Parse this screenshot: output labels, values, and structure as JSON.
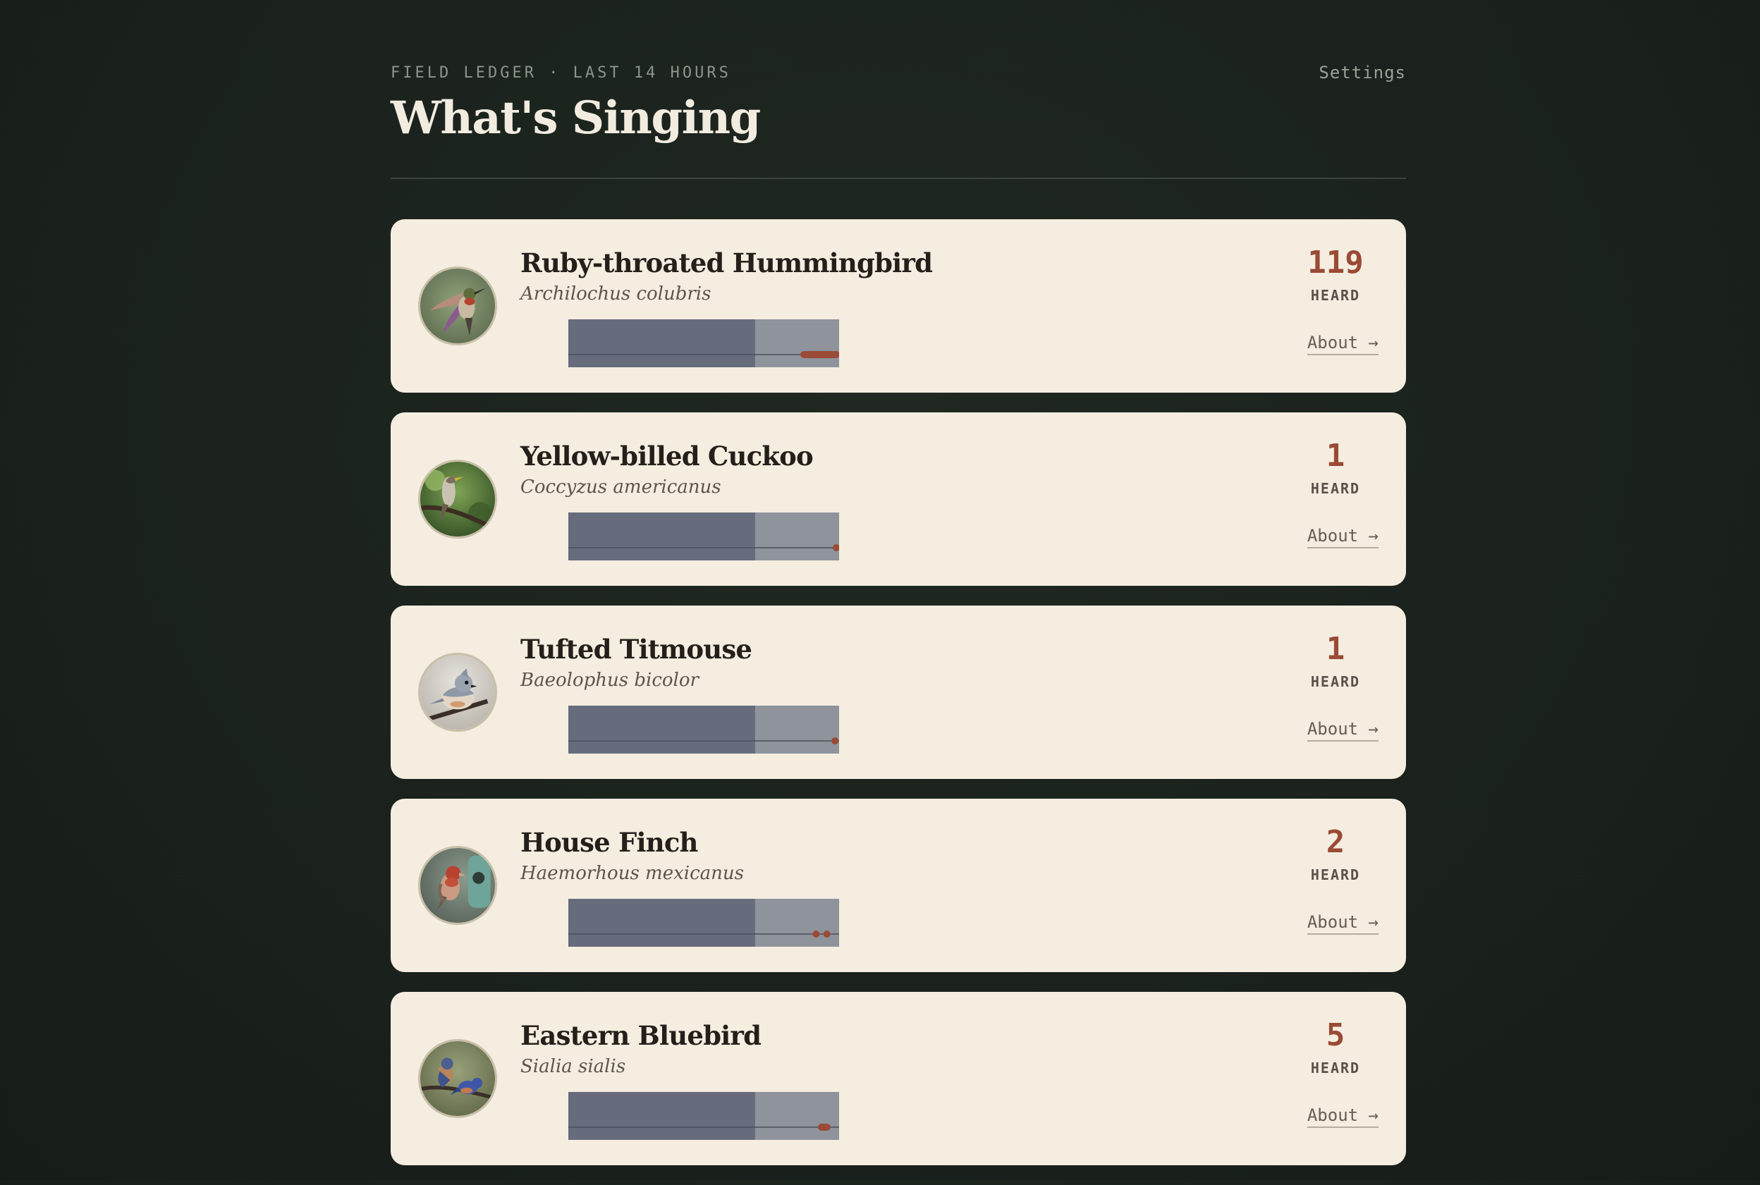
{
  "header": {
    "eyebrow": "FIELD LEDGER · LAST 14 HOURS",
    "title": "What's Singing",
    "settings_label": "Settings"
  },
  "colors": {
    "background": "#1c221e",
    "card": "#f4ede0",
    "accent": "#9a4a35",
    "night_band": "#666c7c",
    "day_band": "#8e939c"
  },
  "species": [
    {
      "common_name": "Ruby-throated Hummingbird",
      "scientific_name": "Archilochus colubris",
      "count": "119",
      "count_label": "HEARD",
      "about_label": "About →",
      "photo": "hummingbird-photo",
      "detection_range": [
        0.87,
        1.0
      ]
    },
    {
      "common_name": "Yellow-billed Cuckoo",
      "scientific_name": "Coccyzus americanus",
      "count": "1",
      "count_label": "HEARD",
      "about_label": "About →",
      "photo": "cuckoo-photo",
      "detections": [
        0.995
      ]
    },
    {
      "common_name": "Tufted Titmouse",
      "scientific_name": "Baeolophus bicolor",
      "count": "1",
      "count_label": "HEARD",
      "about_label": "About →",
      "photo": "titmouse-photo",
      "detections": [
        0.985
      ]
    },
    {
      "common_name": "House Finch",
      "scientific_name": "Haemorhous mexicanus",
      "count": "2",
      "count_label": "HEARD",
      "about_label": "About →",
      "photo": "finch-photo",
      "detections": [
        0.915,
        0.955
      ]
    },
    {
      "common_name": "Eastern Bluebird",
      "scientific_name": "Sialia sialis",
      "count": "5",
      "count_label": "HEARD",
      "about_label": "About →",
      "photo": "bluebird-photo",
      "detections": [
        0.935,
        0.94,
        0.945,
        0.95,
        0.955
      ]
    }
  ],
  "timeline": {
    "night_fraction": 0.69
  }
}
